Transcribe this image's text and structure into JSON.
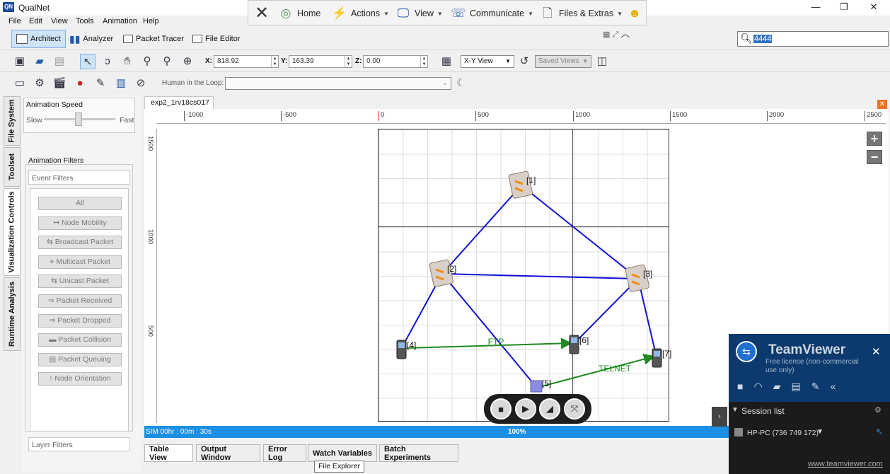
{
  "app": {
    "title": "QualNet"
  },
  "window": {
    "minimize": "—",
    "maximize": "❐",
    "close": "✕"
  },
  "menu": [
    "File",
    "Edit",
    "View",
    "Tools",
    "Animation",
    "Help"
  ],
  "quick": {
    "home": "Home",
    "actions": "Actions",
    "view": "View",
    "communicate": "Communicate",
    "files": "Files & Extras"
  },
  "modes": {
    "architect": "Architect",
    "analyzer": "Analyzer",
    "packet_tracer": "Packet Tracer",
    "file_editor": "File Editor"
  },
  "search": {
    "value": "4444"
  },
  "coords": {
    "x_label": "X:",
    "x": "818.92",
    "y_label": "Y:",
    "y": "163.39",
    "z_label": "Z:",
    "z": "0.00"
  },
  "view_select": "X-Y View",
  "saved_views": "Saved Views",
  "hitl": {
    "label": "Human in the Loop:",
    "value": ""
  },
  "side_tabs": [
    "File System",
    "Toolset",
    "Visualization Controls",
    "Runtime Analysis"
  ],
  "anim": {
    "speed_title": "Animation Speed",
    "slow": "Slow",
    "fast": "Fast",
    "speed_level": 0.5,
    "filters_title": "Animation Filters",
    "event_filters": "Event Filters",
    "layer_filters": "Layer Filters",
    "buttons": [
      "All",
      "Node Mobility",
      "Broadcast Packet",
      "Multicast Packet",
      "Unicast Packet",
      "Packet Received",
      "Packet Dropped",
      "Packet Collision",
      "Packet Queuing",
      "Node Orientation"
    ],
    "icons": [
      "",
      "↦",
      "⇆",
      "⋄",
      "⇆",
      "⇒",
      "⇒",
      "▬",
      "▤",
      "↑"
    ]
  },
  "canvas": {
    "tab": "exp2_1rv18cs017",
    "ruler_h": [
      "-1000",
      "-500",
      "0",
      "500",
      "1000",
      "1500",
      "2000",
      "2500"
    ],
    "ruler_v": [
      "1500",
      "1000",
      "500"
    ],
    "nodes": [
      {
        "id": "1",
        "label": "[1]",
        "kind": "router"
      },
      {
        "id": "2",
        "label": "[2]",
        "kind": "router"
      },
      {
        "id": "3",
        "label": "[3]",
        "kind": "router"
      },
      {
        "id": "4",
        "label": "[4]",
        "kind": "device"
      },
      {
        "id": "5",
        "label": "[5]",
        "kind": "host"
      },
      {
        "id": "6",
        "label": "[6]",
        "kind": "device"
      },
      {
        "id": "7",
        "label": "[7]",
        "kind": "device"
      }
    ],
    "links": [
      [
        "1",
        "2"
      ],
      [
        "1",
        "3"
      ],
      [
        "2",
        "3"
      ],
      [
        "2",
        "4"
      ],
      [
        "2",
        "5"
      ],
      [
        "3",
        "6"
      ],
      [
        "3",
        "7"
      ]
    ],
    "apps": [
      {
        "from": "4",
        "to": "6",
        "label": "FTP"
      },
      {
        "from": "5",
        "to": "7",
        "label": "TELNET"
      }
    ],
    "colors": {
      "link": "#1010d8",
      "app": "#1f8a1f"
    }
  },
  "zoom": {
    "in": "+",
    "out": "−"
  },
  "status": {
    "sim_time": "SIM 00hr : 00m : 30s",
    "progress": "100%",
    "progress_value": 1.0
  },
  "bottom_tabs": [
    "Table View",
    "Output Window",
    "Error Log",
    "Watch Variables",
    "Batch Experiments"
  ],
  "tooltip": "File Explorer",
  "teamviewer": {
    "title": "TeamViewer",
    "license": "Free license (non-commercial use only)",
    "session_list": "Session list",
    "session": "HP-PC (736 749 172)",
    "url": "www.teamviewer.com",
    "close": "✕"
  }
}
